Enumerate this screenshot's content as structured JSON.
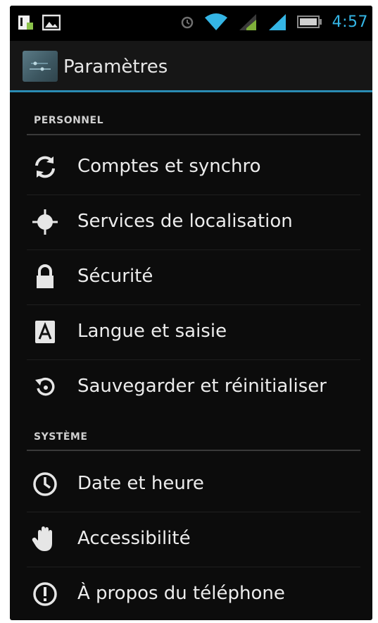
{
  "status_bar": {
    "time": "4:57",
    "icons": [
      "notification-icon",
      "image-icon",
      "alarm-icon",
      "wifi-icon",
      "signal-icon",
      "signal-icon",
      "battery-icon"
    ]
  },
  "action_bar": {
    "title": "Paramètres",
    "icon": "settings-app-icon"
  },
  "sections": [
    {
      "header": "PERSONNEL",
      "items": [
        {
          "label": "Comptes et synchro",
          "icon": "sync-icon"
        },
        {
          "label": "Services de localisation",
          "icon": "location-icon"
        },
        {
          "label": "Sécurité",
          "icon": "lock-icon"
        },
        {
          "label": "Langue et saisie",
          "icon": "keyboard-language-icon"
        },
        {
          "label": "Sauvegarder et réinitialiser",
          "icon": "backup-restore-icon"
        }
      ]
    },
    {
      "header": "SYSTÈME",
      "items": [
        {
          "label": "Date et heure",
          "icon": "clock-icon"
        },
        {
          "label": "Accessibilité",
          "icon": "hand-icon"
        },
        {
          "label": "À propos du téléphone",
          "icon": "info-icon"
        }
      ]
    }
  ],
  "colors": {
    "accent": "#34b5e5",
    "background": "#0c0c0c",
    "action_bar_underline": "#2a8cb4"
  }
}
